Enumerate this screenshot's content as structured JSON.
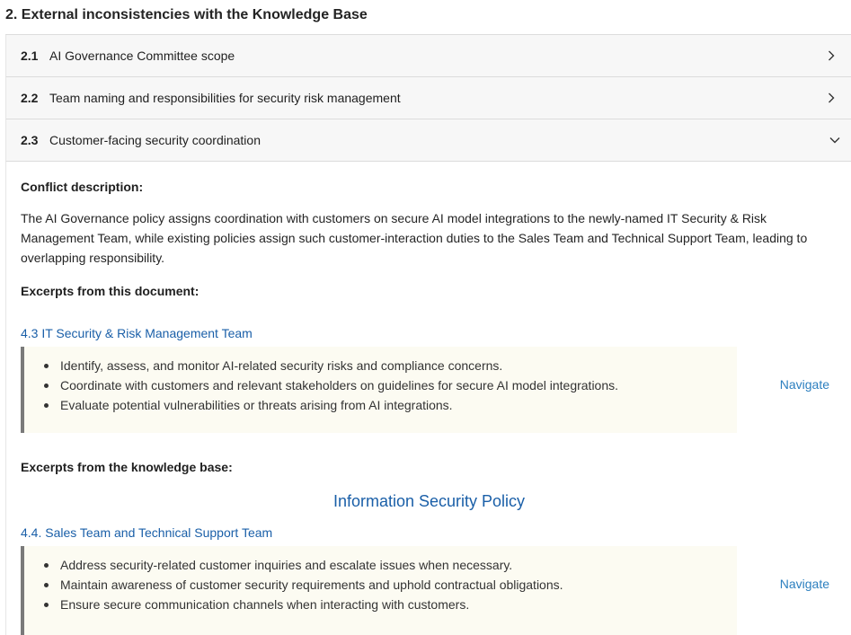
{
  "section": {
    "title": "2. External inconsistencies with the Knowledge Base"
  },
  "accordion": [
    {
      "num": "2.1",
      "label": "AI Governance Committee scope",
      "state": "collapsed"
    },
    {
      "num": "2.2",
      "label": "Team naming and responsibilities for security risk management",
      "state": "collapsed"
    },
    {
      "num": "2.3",
      "label": "Customer-facing security coordination",
      "state": "expanded"
    }
  ],
  "detail": {
    "conflict_label": "Conflict description:",
    "conflict_text": "The AI Governance policy assigns coordination with customers on secure AI model integrations to the newly-named IT Security & Risk Management Team, while existing policies assign such customer-interaction duties to the Sales Team and Technical Support Team, leading to overlapping responsibility.",
    "doc_excerpts_label": "Excerpts from this document:",
    "doc_excerpt": {
      "heading": "4.3 IT Security & Risk Management Team",
      "bullets": [
        "Identify, assess, and monitor AI-related security risks and compliance concerns.",
        "Coordinate with customers and relevant stakeholders on guidelines for secure AI model integrations.",
        "Evaluate potential vulnerabilities or threats arising from AI integrations."
      ],
      "navigate": "Navigate"
    },
    "kb_excerpts_label": "Excerpts from the knowledge base:",
    "kb_title": "Information Security Policy",
    "kb_excerpt": {
      "heading": "4.4. Sales Team and Technical Support Team",
      "bullets": [
        "Address security-related customer inquiries and escalate issues when necessary.",
        "Maintain awareness of customer security requirements and uphold contractual obligations.",
        "Ensure secure communication channels when interacting with customers."
      ],
      "navigate": "Navigate"
    }
  },
  "colors": {
    "link": "#1a5fa8",
    "navigate": "#2c7fbf",
    "excerpt_bg": "#fcfbf2",
    "excerpt_border": "#7a7a7a"
  }
}
